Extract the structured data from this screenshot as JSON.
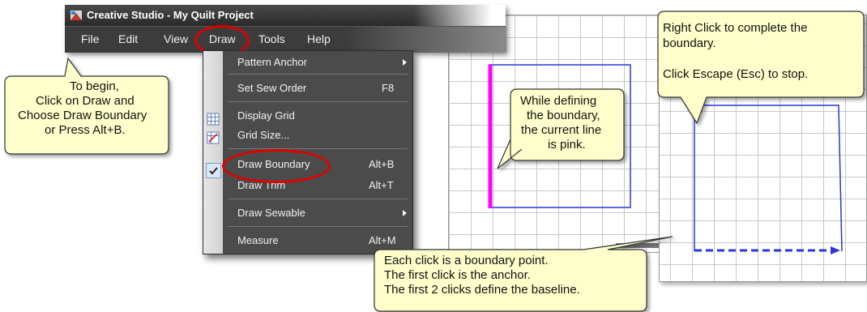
{
  "window": {
    "title": "Creative Studio - My Quilt Project"
  },
  "menubar": {
    "items": [
      "File",
      "Edit",
      "View",
      "Draw",
      "Tools",
      "Help"
    ]
  },
  "draw_menu": {
    "items": [
      {
        "label": "Pattern Anchor",
        "shortcut": "",
        "submenu": true
      },
      {
        "label": "Set Sew Order",
        "shortcut": "F8",
        "submenu": false
      },
      {
        "label": "Display Grid",
        "shortcut": "",
        "submenu": false,
        "icon": "grid-icon"
      },
      {
        "label": "Grid Size...",
        "shortcut": "",
        "submenu": false,
        "icon": "grid-size-icon"
      },
      {
        "label": "Draw Boundary",
        "shortcut": "Alt+B",
        "submenu": false,
        "checked": true
      },
      {
        "label": "Draw Trim",
        "shortcut": "Alt+T",
        "submenu": false
      },
      {
        "label": "Draw Sewable",
        "shortcut": "",
        "submenu": true
      },
      {
        "label": "Measure",
        "shortcut": "Alt+M",
        "submenu": false
      }
    ]
  },
  "callouts": {
    "begin": [
      "To begin,",
      "Click on Draw and",
      "Choose Draw Boundary",
      "or Press Alt+B."
    ],
    "defining": [
      "While defining",
      "the boundary,",
      "the current line",
      "is pink."
    ],
    "right_click": [
      "Right Click to complete the",
      "boundary.",
      "",
      "Click Escape (Esc) to stop."
    ],
    "each_click": [
      "Each click is a boundary point.",
      "The first click is the anchor.",
      "The first 2 clicks define the baseline."
    ]
  },
  "colors": {
    "callout_fill": "#ffffcc",
    "callout_stroke": "#333333",
    "highlight": "#e00000",
    "boundary_line": "#2a35d8",
    "current_line": "#ff00ff",
    "menu_bg": "#4b4b4b"
  }
}
